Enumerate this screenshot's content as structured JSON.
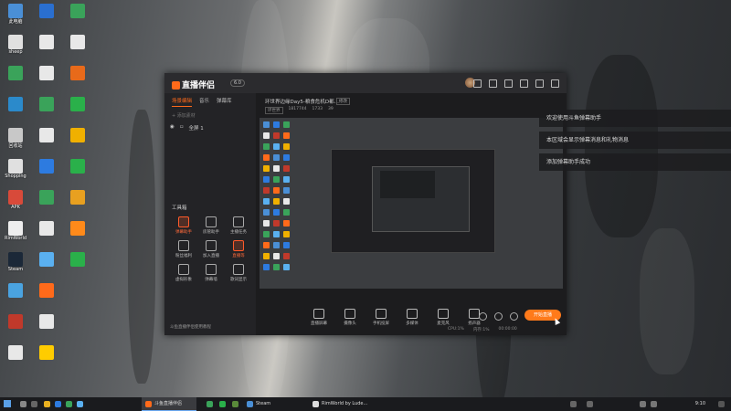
{
  "desktop": {
    "icons": [
      {
        "label": "此电脑",
        "color": "#4a8fd6"
      },
      {
        "label": "sheep",
        "color": "#e0e0e0"
      },
      {
        "label": "",
        "color": "#3aa35a"
      },
      {
        "label": "",
        "color": "#2b8acb"
      },
      {
        "label": "回收站",
        "color": "#c8c8c8"
      },
      {
        "label": "Shopping",
        "color": "#e0e0e0"
      },
      {
        "label": "APK",
        "color": "#d84a3a"
      },
      {
        "label": "RimWorld",
        "color": "#eeeeee"
      },
      {
        "label": "Steam",
        "color": "#1b2838"
      },
      {
        "label": "",
        "color": "#4aa3e0"
      },
      {
        "label": "",
        "color": "#c0392b"
      },
      {
        "label": "",
        "color": "#e8e8e8"
      },
      {
        "label": "",
        "color": "#2a6fd0"
      },
      {
        "label": "",
        "color": "#e8e8e8"
      },
      {
        "label": "",
        "color": "#e8e8e8"
      },
      {
        "label": "",
        "color": "#3aa35a"
      },
      {
        "label": "",
        "color": "#e8e8e8"
      },
      {
        "label": "",
        "color": "#2d7be0"
      },
      {
        "label": "",
        "color": "#3aa35a"
      },
      {
        "label": "",
        "color": "#e8e8e8"
      },
      {
        "label": "",
        "color": "#5ab0f0"
      },
      {
        "label": "",
        "color": "#ff6a1a"
      },
      {
        "label": "",
        "color": "#e8e8e8"
      },
      {
        "label": "",
        "color": "#ffcc00"
      },
      {
        "label": "",
        "color": "#3aa35a"
      },
      {
        "label": "",
        "color": "#e8e8e8"
      },
      {
        "label": "",
        "color": "#e86a1a"
      },
      {
        "label": "",
        "color": "#2ab04a"
      },
      {
        "label": "",
        "color": "#f0b000"
      },
      {
        "label": "",
        "color": "#2ab04a"
      },
      {
        "label": "",
        "color": "#e8a020"
      },
      {
        "label": "",
        "color": "#ff8a1a"
      },
      {
        "label": "",
        "color": "#2ab04a"
      }
    ]
  },
  "window": {
    "logo_text": "直播伴侣",
    "version_badge": "6.0",
    "scene_tabs": [
      "场景编辑",
      "音乐",
      "弹幕库"
    ],
    "add_source": "+ 添加素材",
    "source_row": "全屏 1",
    "tools_title": "工具箱",
    "tools": [
      {
        "label": "弹幕助手",
        "hot": true
      },
      {
        "label": "房管助手",
        "hot": false
      },
      {
        "label": "主播任务",
        "hot": false
      },
      {
        "label": "粉丝福利",
        "hot": false
      },
      {
        "label": "加入直播",
        "hot": false
      },
      {
        "label": "直播等",
        "hot": true
      },
      {
        "label": "虚拟形象",
        "hot": false
      },
      {
        "label": "弹幕墙",
        "hot": false
      },
      {
        "label": "歌词显示",
        "hot": false
      }
    ],
    "left_footer": "斗鱼直播伴侣使用教程",
    "room_title": "环世界边缘Day5-粮食危机D都...",
    "room_edit": "修改",
    "room_meta": [
      "环世界",
      "1817744",
      "1733",
      "39"
    ],
    "bottom_buttons": [
      "直播屏幕",
      "摄像头",
      "手机投屏",
      "多媒体",
      "麦克风",
      "扬声器"
    ],
    "live_button": "开始直播",
    "status": [
      "CPU:1%",
      "内存:1%",
      "00:00:00"
    ]
  },
  "notifications": [
    "欢迎使用斗鱼弹幕助手",
    "本区域会显示弹幕消息和礼物消息",
    "添加弹幕助手成功"
  ],
  "taskbar": {
    "apps": [
      {
        "label": "斗鱼直播伴侣",
        "color": "#ff6a1a",
        "active": true
      },
      {
        "label": "Steam",
        "color": "#4a8fd6",
        "active": false
      },
      {
        "label": "RimWorld by Lude...",
        "color": "#dddddd",
        "active": false
      }
    ],
    "clock": "9:10"
  }
}
